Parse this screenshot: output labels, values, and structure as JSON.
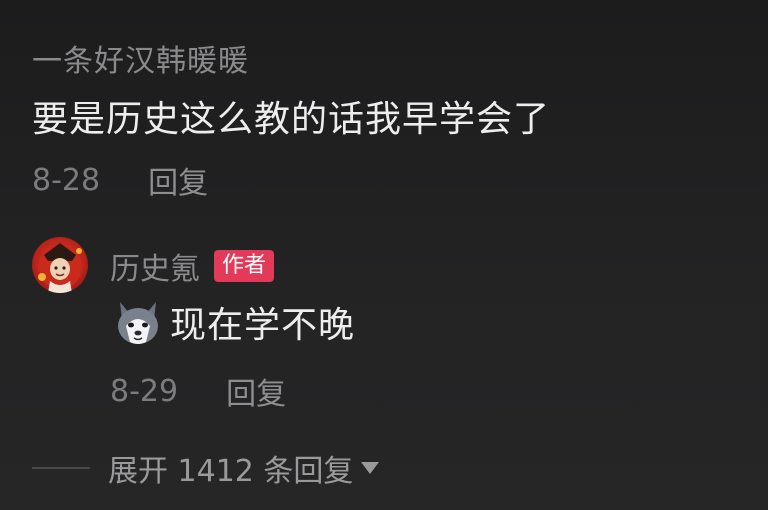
{
  "comment": {
    "username": "一条好汉韩暖暖",
    "text": "要是历史这么教的话我早学会了",
    "date": "8-28",
    "reply_label": "回复"
  },
  "reply": {
    "username": "历史氪",
    "badge": "作者",
    "emoji": "husky-emoji",
    "text": "现在学不晚",
    "date": "8-29",
    "reply_label": "回复"
  },
  "expand": {
    "label": "展开 1412 条回复"
  },
  "colors": {
    "background": "#1e1e1f",
    "author_badge": "#e23a58"
  }
}
